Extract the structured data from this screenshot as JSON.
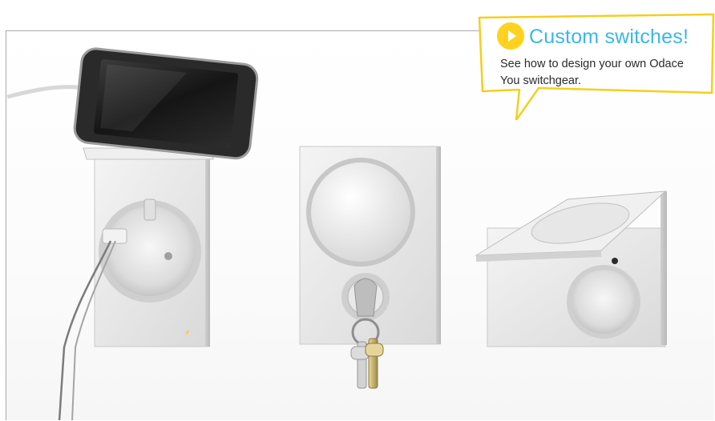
{
  "callout": {
    "title": "Custom switches!",
    "body": "See how to design your own Odace You switchgear.",
    "play_icon": "play-icon"
  },
  "colors": {
    "callout_border": "#f4cf1c",
    "play_button": "#ffd21f",
    "title_accent": "#3ab7e6"
  }
}
